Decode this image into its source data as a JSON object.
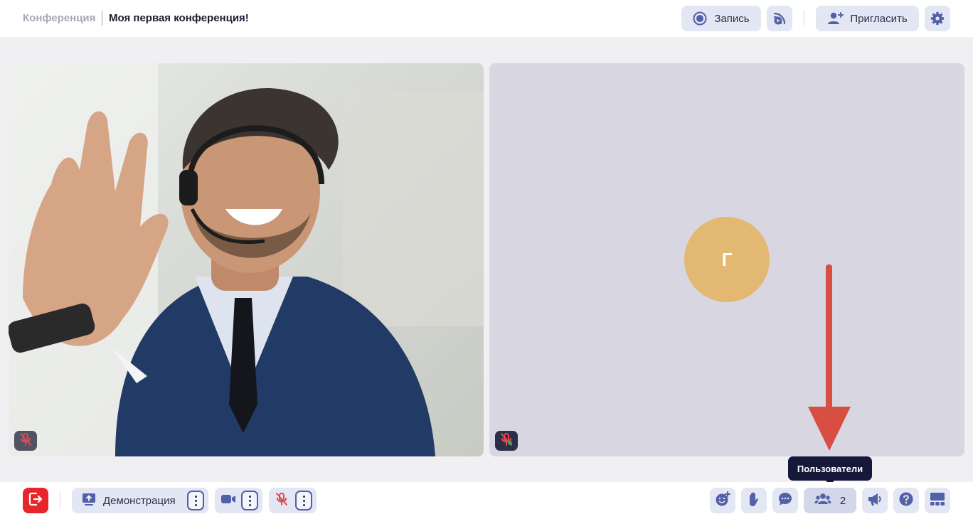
{
  "header": {
    "section": "Конференция",
    "title": "Моя первая конференция!",
    "record_label": "Запись",
    "invite_label": "Пригласить"
  },
  "tiles": [
    {
      "type": "video",
      "mic_status": "muted"
    },
    {
      "type": "avatar",
      "avatar_letter": "Г",
      "avatar_color": "#e3b873",
      "mic_status": "muted"
    }
  ],
  "tooltip": {
    "text": "Пользователи"
  },
  "toolbar": {
    "demo_label": "Демонстрация",
    "users_count": "2"
  },
  "colors": {
    "accent": "#5160a8",
    "leave": "#e8252a",
    "arrow": "#d94e43",
    "muted_mic": "#e04a52"
  },
  "icons": {
    "record": "record-icon",
    "stream": "stream-icon",
    "invite": "add-user-icon",
    "settings": "gear-icon",
    "leave": "exit-icon",
    "demo": "screen-share-icon",
    "camera": "video-camera-icon",
    "mic": "mic-off-icon",
    "reaction": "emoji-add-icon",
    "hand": "raise-hand-icon",
    "chat": "chat-icon",
    "users": "users-icon",
    "announce": "megaphone-icon",
    "help": "help-icon",
    "layout": "layout-icon"
  }
}
